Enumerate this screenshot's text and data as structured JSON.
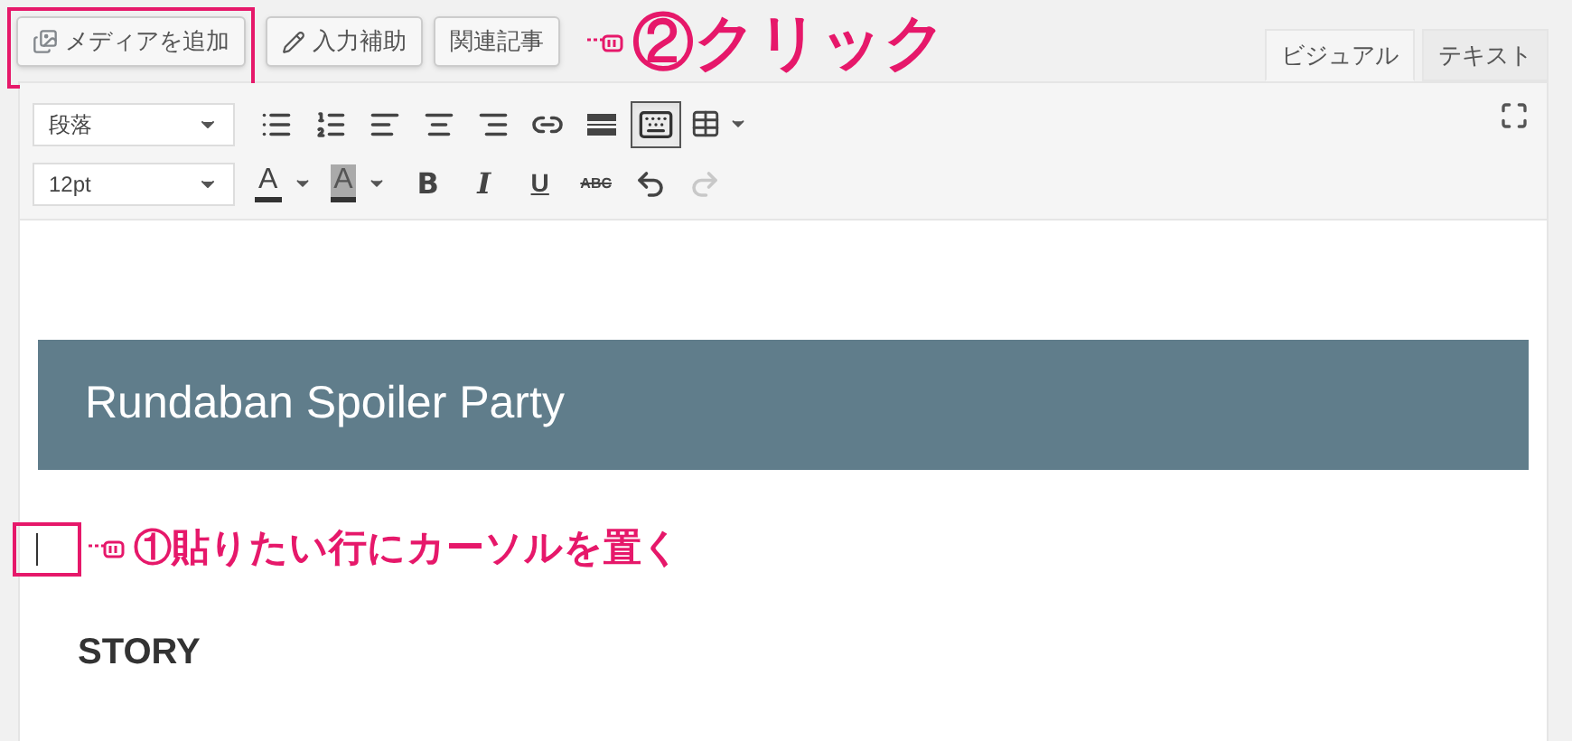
{
  "media_buttons": [
    {
      "label": "メディアを追加",
      "highlighted": true
    },
    {
      "label": "入力補助",
      "highlighted": false
    },
    {
      "label": "関連記事",
      "highlighted": false
    }
  ],
  "click_annotation": {
    "text": "②クリック"
  },
  "tabs": [
    {
      "label": "ビジュアル",
      "selected": true
    },
    {
      "label": "テキスト",
      "selected": false
    }
  ],
  "toolbar": {
    "row_1": [
      {
        "kind": "select",
        "text": "段落"
      },
      {
        "kind": "bullets"
      },
      {
        "kind": "numbers"
      },
      {
        "kind": "left"
      },
      {
        "kind": "center"
      },
      {
        "kind": "right"
      },
      {
        "kind": "link"
      },
      {
        "kind": "more"
      },
      {
        "kind": "toggle",
        "pressed": true
      },
      {
        "kind": "table"
      }
    ],
    "row_2": [
      {
        "kind": "select",
        "text": "12pt"
      },
      {
        "kind": "color",
        "text": "A"
      },
      {
        "kind": "highlight",
        "text": "A"
      },
      {
        "kind": "bold",
        "text": "B"
      },
      {
        "kind": "italic",
        "text": "I"
      },
      {
        "kind": "underline",
        "text": "U"
      },
      {
        "kind": "strike",
        "text": "ABC"
      },
      {
        "kind": "undo",
        "disabled": false
      },
      {
        "kind": "redo",
        "disabled": true
      }
    ]
  },
  "content": {
    "heading": "Rundaban Spoiler Party",
    "cursor_annotation": "①貼りたい行にカーソルを置く",
    "paragraph": "STORY"
  }
}
